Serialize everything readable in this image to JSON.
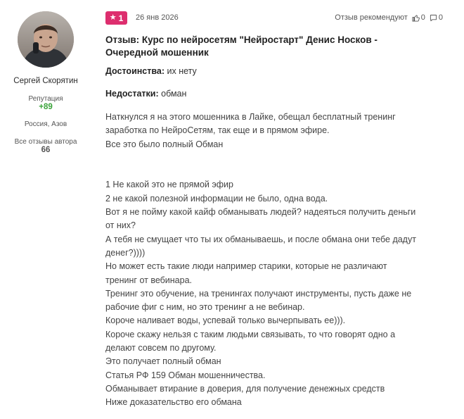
{
  "author": {
    "name": "Сергей Скорятин",
    "reputation_label": "Репутация",
    "reputation_value": "+89",
    "location": "Россия, Азов",
    "all_reviews_label": "Все отзывы автора",
    "all_reviews_count": "66"
  },
  "review": {
    "rating": "1",
    "date": "26 янв 2026",
    "recommend_label": "Отзыв рекомендуют",
    "likes": "0",
    "comments": "0",
    "title": "Отзыв: Курс по нейросетям \"Нейростарт\" Денис Носков - Очередной мошенник",
    "pros_label": "Достоинства:",
    "pros_value": " их нету",
    "cons_label": "Недостатки:",
    "cons_value": " обман",
    "paragraphs_top": [
      "Наткнулся я на этого мошенника в Лайке, обещал бесплатный тренинг",
      "заработка по НейроСетям, так еще и в прямом эфире.",
      "Все это было полный Обман"
    ],
    "paragraphs_bottom": [
      "1 Не какой это не прямой эфир",
      "2 не какой полезной информации не было, одна вода.",
      "Вот я не пойму какой кайф обманывать людей? надеяться получить деньги",
      "от них?",
      "А тебя не смущает что ты их обманываешь, и после обмана они тебе дадут",
      "денег?))))",
      "Но может есть такие люди например старики, которые не различают",
      "тренинг от вебинара.",
      "Тренинг это обучение, на тренингах получают инструменты, пусть даже не",
      "рабочие фиг с ним, но это тренинг а не вебинар.",
      "Короче наливает воды, успевай только вычерпывать ее))).",
      "Короче скажу нельзя с таким людьми связывать, то что говорят одно а",
      "делают совсем по другому.",
      "Это получает полный обман",
      "Статья РФ 159 Обман мошенничества.",
      "Обманывает втирание в доверия, для получение денежных средств",
      "Ниже доказательство его обмана"
    ]
  },
  "icons": {
    "rating": "star-icon",
    "likes": "thumbs-up-icon",
    "comments": "comment-icon"
  },
  "colors": {
    "rating_badge": "#dd2e6e",
    "reputation": "#3aa33a"
  }
}
